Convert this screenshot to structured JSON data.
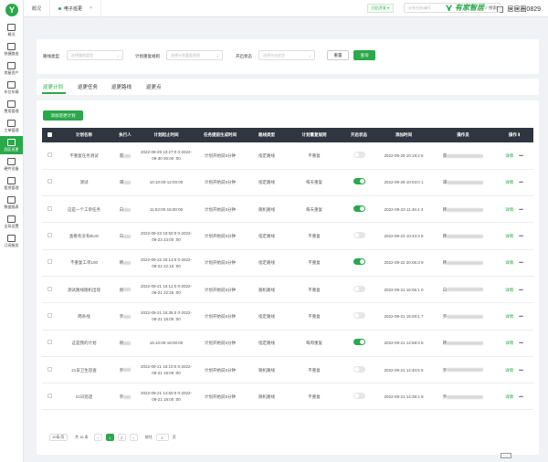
{
  "sidebar": {
    "items": [
      {
        "label": "概况",
        "icon": "monitor-icon"
      },
      {
        "label": "快捷路由",
        "icon": "route-icon"
      },
      {
        "label": "房屋资产",
        "icon": "house-icon"
      },
      {
        "label": "车位车辆",
        "icon": "car-icon"
      },
      {
        "label": "费用管理",
        "icon": "bill-icon"
      },
      {
        "label": "工单管理",
        "icon": "ticket-icon"
      },
      {
        "label": "园区巡更",
        "icon": "patrol-icon"
      },
      {
        "label": "硬件设备",
        "icon": "device-icon"
      },
      {
        "label": "租赁管理",
        "icon": "lease-icon"
      },
      {
        "label": "数据报表",
        "icon": "report-icon"
      },
      {
        "label": "全局设置",
        "icon": "settings-icon"
      },
      {
        "label": "订阅服务",
        "icon": "subscription-icon"
      }
    ]
  },
  "topbar": {
    "tabs": [
      {
        "label": "概况"
      },
      {
        "label": "电子巡更",
        "close": "×"
      }
    ],
    "brand": "有家智居",
    "user": "居居圈0829"
  },
  "toolbar": {
    "quick_label": "日后开发 ▾",
    "search_placeholder": "计划名称/编号",
    "search_btn": "搜索"
  },
  "filters": {
    "route_type_label": "路线类型",
    "route_type_placeholder": "选择路线类型",
    "repeat_rule_label": "计划重复规则",
    "repeat_rule_placeholder": "选择计划重复规则",
    "status_label": "开启状态",
    "status_placeholder": "选择开启状态",
    "reset": "重置",
    "query": "查询"
  },
  "subtabs": [
    "巡更计划",
    "巡更任务",
    "巡更路线",
    "巡更点"
  ],
  "main": {
    "add_button": "添加巡更计划",
    "columns": [
      "计划名称",
      "执行人",
      "计划起止时间",
      "任务提前生成时间",
      "路线类型",
      "计划重复规则",
      "开启状态",
      "添加时间",
      "操作员",
      "操作"
    ],
    "rows": [
      {
        "name": "不重复任务测试",
        "exec": "雷",
        "time": "2022-09-29 10:27:0 0-2022-09-30 00:00 :00",
        "ahead": "计划开始前5分钟",
        "route": "指定路线",
        "repeat": "不重复",
        "on": false,
        "added": "2022-09-29 10:19:2 6",
        "op": "雷"
      },
      {
        "name": "测试",
        "exec": "谭",
        "time": "10:10:00-12:00:00",
        "ahead": "计划开始前5分钟",
        "route": "指定路线",
        "repeat": "每天重复",
        "on": true,
        "added": "2022-09-29 10:04:0 1",
        "op": "谭"
      },
      {
        "name": "这是一个工单任务",
        "exec": "白",
        "time": "11:53:00-15:00:00",
        "ahead": "计划开始前5分钟",
        "route": "随机路线",
        "repeat": "每天重复",
        "on": true,
        "added": "2022-09-23 11:46:4 3",
        "op": "韩"
      },
      {
        "name": "查看有没有BUG",
        "exec": "白",
        "time": "2022-09-23 10:50:0 0-2022-09-23 23:00 :00",
        "ahead": "计划开始前5分钟",
        "route": "指定路线",
        "repeat": "不重复",
        "on": false,
        "added": "2022-09-23 10:43:3 8",
        "op": "韩"
      },
      {
        "name": "不重复工单100",
        "exec": "韩",
        "time": "2022-09-22 20:13:0 0-2022-09-22 22:15 :00",
        "ahead": "计划开始前5分钟",
        "route": "指定路线",
        "repeat": "不重复",
        "on": true,
        "added": "2022-09-22 20:05:3 9",
        "op": "韩"
      },
      {
        "name": "测试路线随机出现",
        "exec": "刚",
        "time": "2022-09-21 16:12:0 0-2022-09-21 22:26 :00",
        "ahead": "计划开始前5分钟",
        "route": "随机路线",
        "repeat": "不重复",
        "on": false,
        "added": "2022-09-21 16:06:1 0",
        "op": "白"
      },
      {
        "name": "两条线",
        "exec": "罗",
        "time": "2022-09-21 15:35:0 0-2022-09-21 18:00 :00",
        "ahead": "计划开始前5分钟",
        "route": "指定路线",
        "repeat": "不重复",
        "on": false,
        "added": "2022-09-21 15:29:1 7",
        "op": "罗"
      },
      {
        "name": "这是我的计划",
        "exec": "刚",
        "time": "15:10:00-18:00:00",
        "ahead": "计划开始前5分钟",
        "route": "指定路线",
        "repeat": "每周重复",
        "on": true,
        "added": "2022-09-21 14:58:3 5",
        "op": "韩"
      },
      {
        "name": "21日卫生巡查",
        "exec": "罗",
        "time": "2022-09-21 15:10:0 0-2022-09-21 18:00 :00",
        "ahead": "计划开始前5分钟",
        "route": "随机路线",
        "repeat": "不重复",
        "on": false,
        "added": "2022-09-21 14:40:5 6",
        "op": "罗"
      },
      {
        "name": "21日巡逻",
        "exec": "罗",
        "time": "2022-09-21 14:50:0 0-2022-09-21 18:00 :00",
        "ahead": "计划开始前5分钟",
        "route": "随机路线",
        "repeat": "不重复",
        "on": false,
        "added": "2022-09-21 14:38:1 9",
        "op": "罗"
      }
    ],
    "op_detail": "详情",
    "op_more": "•••"
  },
  "pager": {
    "size": "10条/页",
    "total": "共 16 条",
    "prev": "‹",
    "pages": [
      "1",
      "2"
    ],
    "next": "›",
    "goto": "前往",
    "goto_value": "1",
    "page_unit": "页"
  },
  "colors": {
    "accent": "#2aa84a",
    "header_bg": "#2f3640"
  }
}
